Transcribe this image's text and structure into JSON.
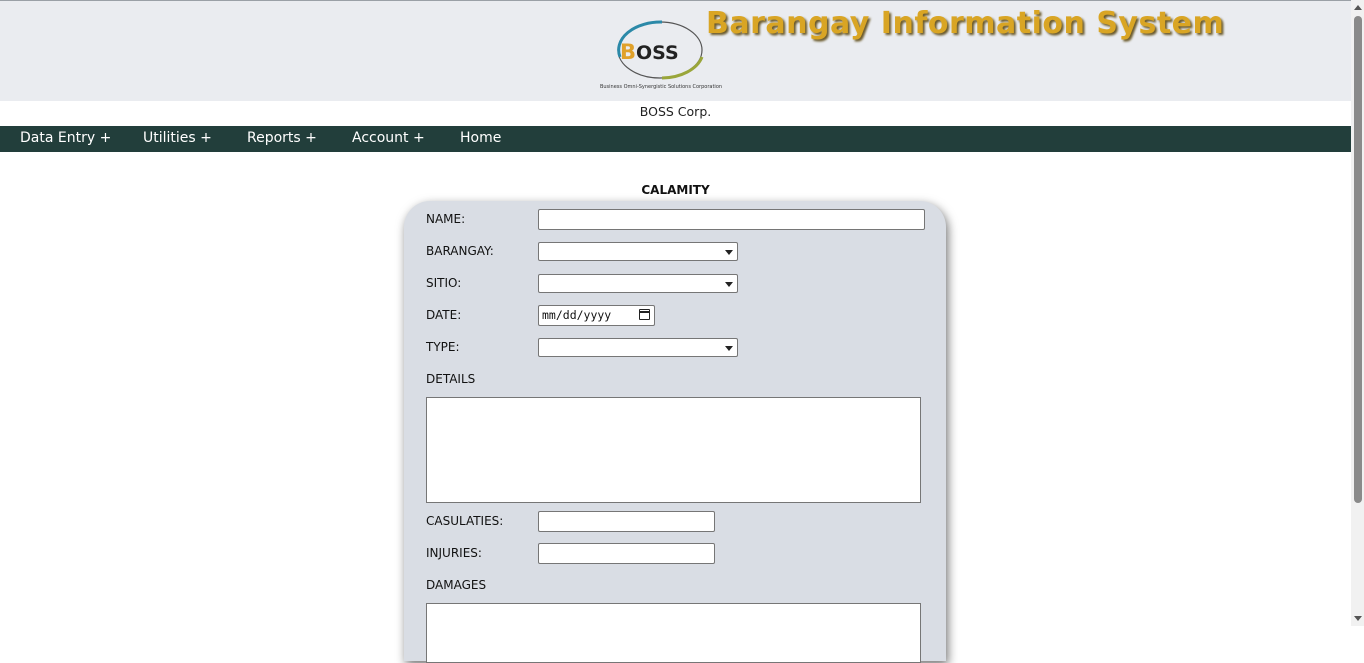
{
  "header": {
    "logo_text": "BOSS",
    "logo_caption": "Business Omni-Synergistic Solutions Corporation",
    "app_title": "Barangay Information System",
    "company": "BOSS Corp."
  },
  "nav": {
    "items": [
      {
        "label": "Data Entry +"
      },
      {
        "label": "Utilities +"
      },
      {
        "label": "Reports +"
      },
      {
        "label": "Account +"
      },
      {
        "label": "Home"
      }
    ]
  },
  "form": {
    "title": "CALAMITY",
    "name_label": "NAME:",
    "name_value": "",
    "barangay_label": "BARANGAY:",
    "barangay_value": "",
    "sitio_label": "SITIO:",
    "sitio_value": "",
    "date_label": "DATE:",
    "date_placeholder": "mm/dd/yyyy",
    "type_label": "TYPE:",
    "type_value": "",
    "details_label": "DETAILS",
    "details_value": "",
    "casualties_label": "CASULATIES:",
    "casualties_value": "",
    "injuries_label": "INJURIES:",
    "injuries_value": "",
    "damages_label": "DAMAGES",
    "damages_value": ""
  },
  "colors": {
    "banner_bg": "#eaecf0",
    "title_gold": "#d9a524",
    "navbar_bg": "#223e3b",
    "card_bg": "#d9dde4"
  },
  "icons": {
    "logo": "boss-swoosh-logo",
    "select_arrow": "chevron-down-icon",
    "date_picker": "calendar-icon"
  }
}
